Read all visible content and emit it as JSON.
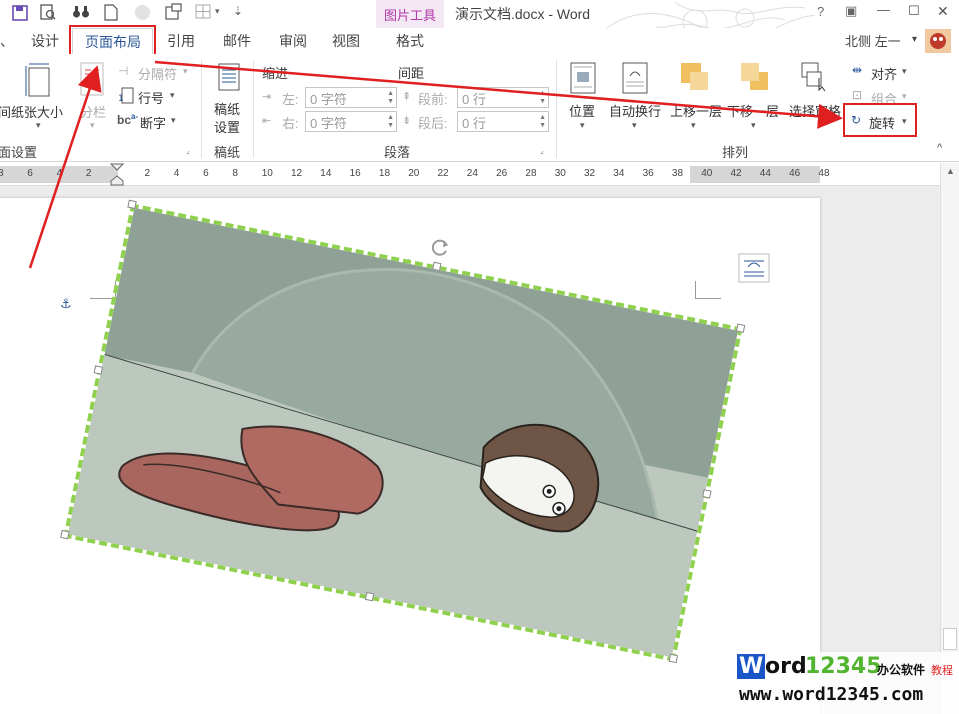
{
  "window": {
    "title": "演示文档.docx - Word",
    "contextual_tab": "图片工具",
    "help": "?",
    "restore": "▣",
    "minimize": "—",
    "maximize": "☐",
    "close": "✕"
  },
  "user": {
    "name": "北侧 左一",
    "dropdown": "▾"
  },
  "tabs": [
    "设计",
    "页面布局",
    "引用",
    "邮件",
    "审阅",
    "视图",
    "格式"
  ],
  "tab_left_partial": "、",
  "page_setup": {
    "margins_partial": "间",
    "paper_size": "纸张大小",
    "columns": "分栏",
    "breaks": "分隔符",
    "line_numbers": "行号",
    "hyphenation": "断字",
    "label": "面设置"
  },
  "draft": {
    "button": "稿纸设置",
    "btn_line1": "稿纸",
    "btn_line2": "设置",
    "label": "稿纸"
  },
  "paragraph": {
    "indent_header": "缩进",
    "spacing_header": "间距",
    "left_label": "左:",
    "right_label": "右:",
    "before_label": "段前:",
    "after_label": "段后:",
    "left_value": "0 字符",
    "right_value": "0 字符",
    "before_value": "0 行",
    "after_value": "0 行",
    "label": "段落"
  },
  "arrange": {
    "position": "位置",
    "wrap_text": "自动换行",
    "bring_forward": "上移一层",
    "send_backward": "下移一层",
    "selection_pane": "选择窗格",
    "align": "对齐",
    "group": "组合",
    "rotate": "旋转",
    "label": "排列"
  },
  "ruler_ticks": [
    "8",
    "6",
    "4",
    "2",
    "",
    "2",
    "4",
    "6",
    "8",
    "10",
    "12",
    "14",
    "16",
    "18",
    "20",
    "22",
    "24",
    "26",
    "28",
    "30",
    "32",
    "34",
    "36",
    "38",
    "40",
    "42",
    "44",
    "46",
    "48"
  ],
  "doc": {
    "para_mark": "↵",
    "anchor_icon": "⚓"
  },
  "watermark": {
    "brand_w": "W",
    "brand_ord": "ord",
    "brand_num": "12345",
    "brand_cn": "办公软件",
    "brand_sub": "教程",
    "url": "www.word12345.com"
  },
  "colors": {
    "accent_red": "#e02020",
    "word_blue": "#2b579a",
    "pic_tools": "#b03aa9",
    "selection_green": "#8fd14f",
    "wm_blue": "#1a56c8",
    "wm_green": "#52b52f"
  }
}
